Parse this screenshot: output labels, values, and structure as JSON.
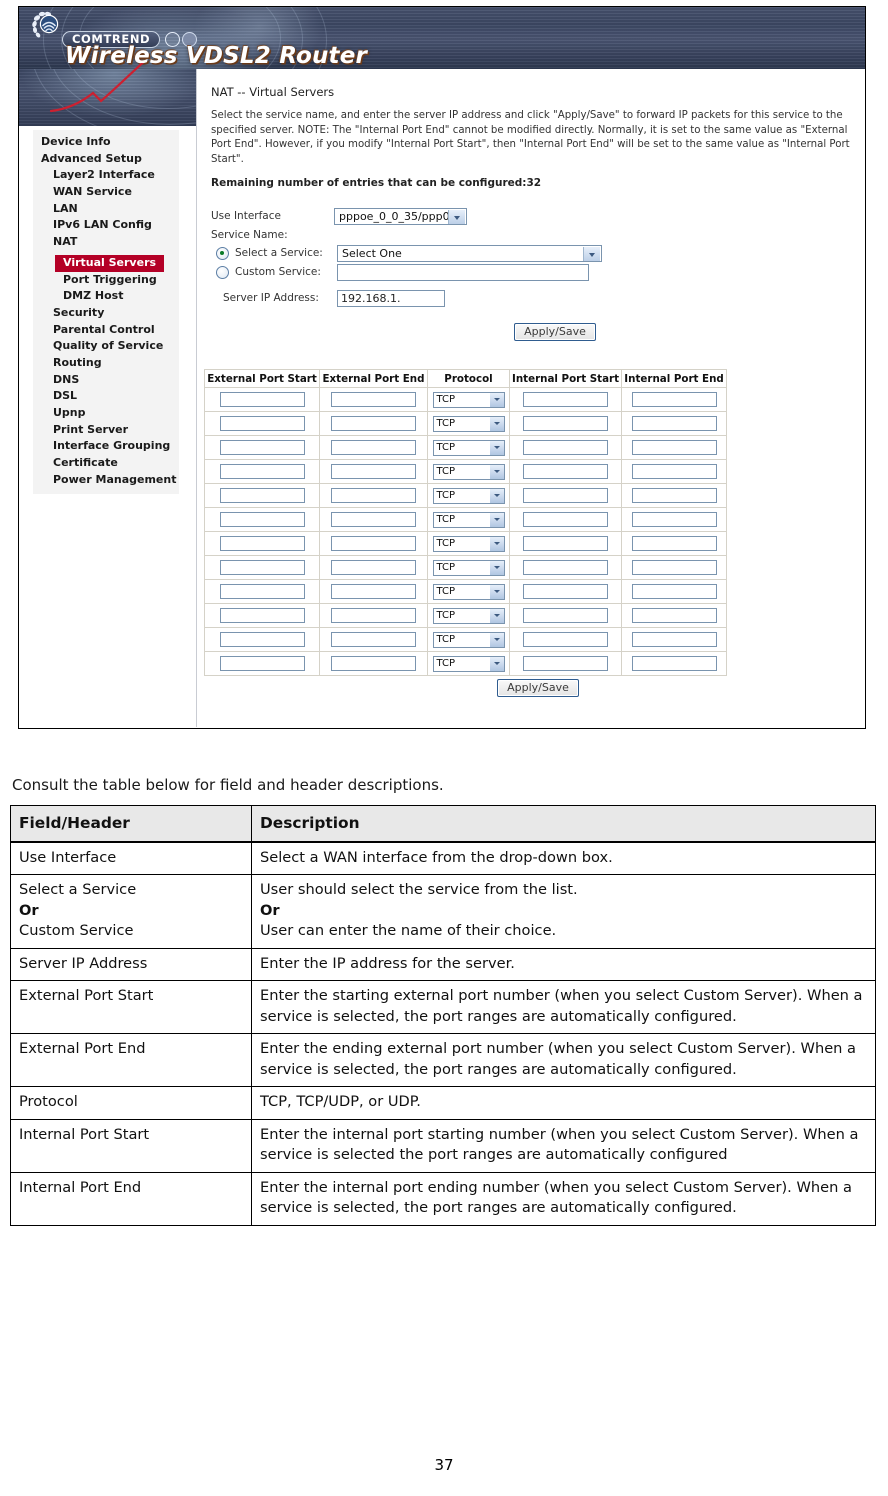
{
  "router": {
    "brand": "COMTREND",
    "model_title": "Wireless VDSL2 Router",
    "page_title": "NAT -- Virtual Servers",
    "description": "Select the service name, and enter the server IP address and click \"Apply/Save\" to forward IP packets for this service to the specified server. NOTE: The \"Internal Port End\" cannot be modified directly. Normally, it is set to the same value as \"External Port End\". However, if you modify \"Internal Port Start\", then \"Internal Port End\" will be set to the same value as \"Internal Port Start\".",
    "remaining": "Remaining number of entries that can be configured:32",
    "sidebar": [
      {
        "label": "Device Info",
        "level": 0,
        "selected": false
      },
      {
        "label": "Advanced Setup",
        "level": 0,
        "selected": false
      },
      {
        "label": "Layer2 Interface",
        "level": 1,
        "selected": false
      },
      {
        "label": "WAN Service",
        "level": 1,
        "selected": false
      },
      {
        "label": "LAN",
        "level": 1,
        "selected": false
      },
      {
        "label": "IPv6 LAN Config",
        "level": 1,
        "selected": false
      },
      {
        "label": "NAT",
        "level": 1,
        "selected": false
      },
      {
        "label": "Virtual Servers",
        "level": 2,
        "selected": true
      },
      {
        "label": "Port Triggering",
        "level": 2,
        "selected": false
      },
      {
        "label": "DMZ Host",
        "level": 2,
        "selected": false
      },
      {
        "label": "Security",
        "level": 1,
        "selected": false
      },
      {
        "label": "Parental Control",
        "level": 1,
        "selected": false
      },
      {
        "label": "Quality of Service",
        "level": 1,
        "selected": false
      },
      {
        "label": "Routing",
        "level": 1,
        "selected": false
      },
      {
        "label": "DNS",
        "level": 1,
        "selected": false
      },
      {
        "label": "DSL",
        "level": 1,
        "selected": false
      },
      {
        "label": "Upnp",
        "level": 1,
        "selected": false
      },
      {
        "label": "Print Server",
        "level": 1,
        "selected": false
      },
      {
        "label": "Interface Grouping",
        "level": 1,
        "selected": false
      },
      {
        "label": "Certificate",
        "level": 1,
        "selected": false
      },
      {
        "label": "Power Management",
        "level": 1,
        "selected": false
      }
    ],
    "form": {
      "use_interface_label": "Use Interface",
      "use_interface_value": "pppoe_0_0_35/ppp0",
      "service_name_label": "Service Name:",
      "select_service_label": "Select a Service:",
      "select_service_value": "Select One",
      "custom_service_label": "Custom Service:",
      "custom_service_value": "",
      "server_ip_label": "Server IP Address:",
      "server_ip_value": "192.168.1.",
      "apply_save_top": "Apply/Save",
      "apply_save_bottom": "Apply/Save"
    },
    "ports_table": {
      "headers": [
        "External Port Start",
        "External Port End",
        "Protocol",
        "Internal Port Start",
        "Internal Port End"
      ],
      "protocol_default": "TCP",
      "row_count": 12
    }
  },
  "doc": {
    "intro": "Consult the table below for field and header descriptions.",
    "table": {
      "headers": [
        "Field/Header",
        "Description"
      ],
      "rows": [
        {
          "field": "Use Interface",
          "desc": "Select a WAN interface from the drop-down box."
        },
        {
          "field_lines": [
            "Select a Service",
            "Or",
            "Custom Service"
          ],
          "desc_lines": [
            "User should select the service from the list.",
            "Or",
            "User can enter the name of their choice."
          ]
        },
        {
          "field": "Server IP Address",
          "desc": "Enter the IP address for the server."
        },
        {
          "field": "External Port Start",
          "desc": "Enter the starting external port number (when you select Custom Server). When a service is selected, the port ranges are automatically configured."
        },
        {
          "field": "External Port End",
          "desc": "Enter the ending external port number (when you select Custom Server). When a service is selected, the port ranges are automatically configured."
        },
        {
          "field": "Protocol",
          "desc": "TCP, TCP/UDP, or UDP."
        },
        {
          "field": "Internal Port Start",
          "desc": "Enter the internal port starting number (when you select Custom Server). When a service is selected the port ranges are automatically configured"
        },
        {
          "field": "Internal Port End",
          "desc": "Enter the internal port ending number (when you select Custom Server). When a service is selected, the port ranges are automatically configured."
        }
      ]
    }
  },
  "page_number": "37",
  "colors": {
    "selected_menu": "#b40026",
    "banner": "#3d4864",
    "doc_header_bg": "#e8e8e8"
  }
}
